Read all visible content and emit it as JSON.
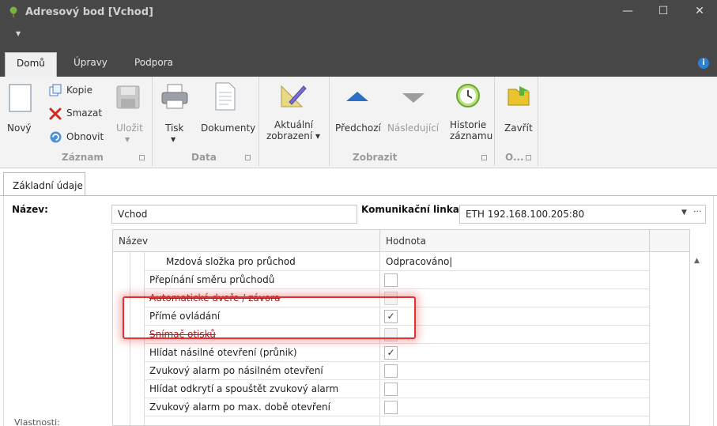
{
  "window": {
    "title": "Adresový bod [Vchod]",
    "minimize": "—",
    "maximize": "☐",
    "close": "✕"
  },
  "tabs": [
    {
      "label": "Domů",
      "active": true
    },
    {
      "label": "Úpravy",
      "active": false
    },
    {
      "label": "Podpora",
      "active": false
    }
  ],
  "info_label": "i",
  "ribbon": {
    "groups": [
      {
        "label": "Záznam"
      },
      {
        "label": "Data"
      },
      {
        "label": "Zobrazit"
      },
      {
        "label": "O..."
      }
    ],
    "buttons": {
      "novy": "Nový",
      "kopie": "Kopie",
      "smazat": "Smazat",
      "obnovit": "Obnovit",
      "ulozit": "Uložit",
      "tisk": "Tisk",
      "dokumenty": "Dokumenty",
      "aktualni_1": "Aktuální",
      "aktualni_2": "zobrazení ▾",
      "predchozi": "Předchozí",
      "nasledujici": "Následující",
      "historie_1": "Historie",
      "historie_2": "záznamu",
      "zavrit": "Zavřít"
    }
  },
  "doc_tab": "Základní údaje",
  "form": {
    "nazev_label": "Název:",
    "nazev_value": "Vchod",
    "linka_label": "Komunikační linka:",
    "linka_value": "ETH 192.168.100.205:80",
    "vlastnosti_label": "Vlastnosti:"
  },
  "grid": {
    "col_name": "Název",
    "col_value": "Hodnota",
    "rows": [
      {
        "label": "Mzdová složka pro průchod",
        "value": "Odpracováno|",
        "type": "text",
        "indent": 2
      },
      {
        "label": "Přepínání směru průchodů",
        "checked": false,
        "type": "check",
        "indent": 1
      },
      {
        "label": "Automatické dveře / závora",
        "checked": false,
        "type": "check-disabled",
        "indent": 1
      },
      {
        "label": "Přímé ovládání",
        "checked": true,
        "type": "check",
        "indent": 1
      },
      {
        "label": "Snímač otisků",
        "checked": false,
        "type": "check-disabled",
        "indent": 1
      },
      {
        "label": "Hlídat násilné otevření (průnik)",
        "checked": true,
        "type": "check",
        "indent": 1
      },
      {
        "label": "Zvukový alarm po násilném otevření",
        "checked": false,
        "type": "check",
        "indent": 1
      },
      {
        "label": "Hlídat odkrytí a spouštět zvukový alarm",
        "checked": false,
        "type": "check",
        "indent": 1
      },
      {
        "label": "Zvukový alarm po max. době otevření",
        "checked": false,
        "type": "check",
        "indent": 1
      }
    ]
  },
  "check_mark": "✓",
  "colors": {
    "titlebar": "#474747",
    "ribbon": "#f3f3f3",
    "highlight": "#e53030",
    "info": "#2d7fd1"
  }
}
